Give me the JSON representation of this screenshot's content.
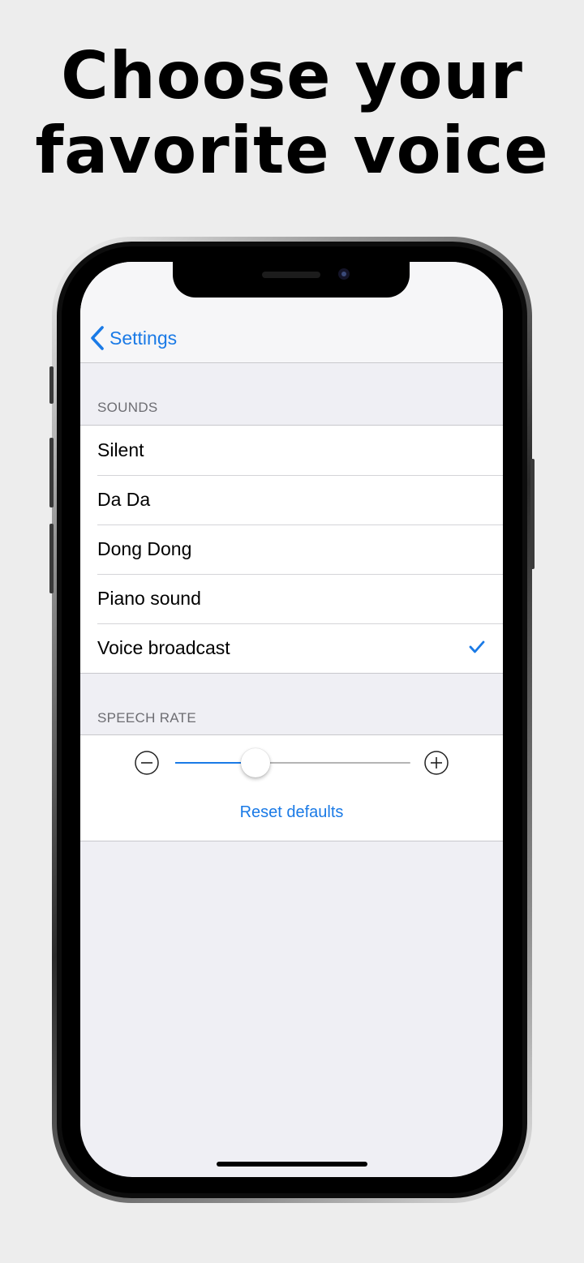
{
  "headline": {
    "line1": "Choose your",
    "line2": "favorite voice"
  },
  "nav": {
    "back_label": "Settings"
  },
  "sounds": {
    "header": "SOUNDS",
    "items": [
      {
        "label": "Silent",
        "selected": false
      },
      {
        "label": "Da Da",
        "selected": false
      },
      {
        "label": "Dong Dong",
        "selected": false
      },
      {
        "label": "Piano sound",
        "selected": false
      },
      {
        "label": "Voice broadcast",
        "selected": true
      }
    ]
  },
  "speech_rate": {
    "header": "SPEECH RATE",
    "value_fraction": 0.34,
    "reset_label": "Reset defaults"
  },
  "colors": {
    "accent": "#1a7ae6",
    "grouped_background": "#efeff4",
    "separator": "#c8c8cc"
  },
  "icons": {
    "back": "chevron-left-icon",
    "selected": "checkmark-icon",
    "decrease": "minus-circle-icon",
    "increase": "plus-circle-icon"
  }
}
